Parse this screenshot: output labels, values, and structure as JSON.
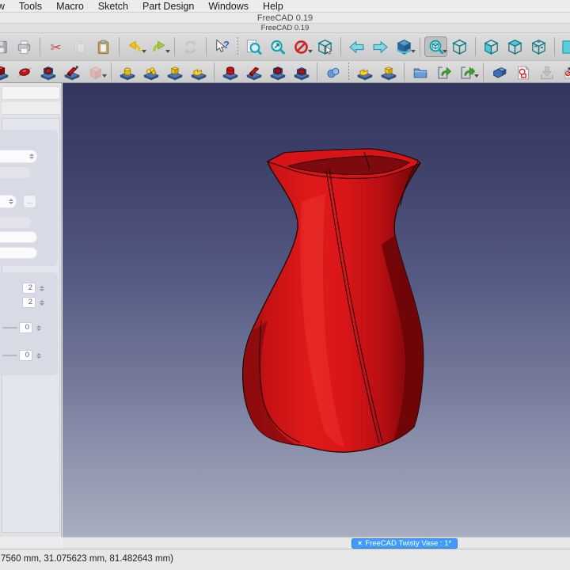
{
  "window": {
    "title": "FreeCAD 0.19",
    "inner_title": "FreeCAD 0.19"
  },
  "menu": {
    "items": [
      "View",
      "Tools",
      "Macro",
      "Sketch",
      "Part Design",
      "Windows",
      "Help"
    ]
  },
  "toolbar1": {
    "items": [
      {
        "name": "save-icon",
        "kind": "floppy",
        "partial": true
      },
      {
        "name": "print-icon",
        "kind": "printer"
      },
      {
        "sep": 1
      },
      {
        "name": "cut-icon",
        "kind": "scissors"
      },
      {
        "name": "copy-icon",
        "kind": "copy",
        "grayed": true
      },
      {
        "name": "paste-icon",
        "kind": "clipboard"
      },
      {
        "sep": 1
      },
      {
        "name": "undo-icon",
        "kind": "undo",
        "caret": true
      },
      {
        "name": "redo-icon",
        "kind": "redo",
        "caret": true
      },
      {
        "sep": 1
      },
      {
        "name": "refresh-icon",
        "kind": "refresh",
        "grayed": true
      },
      {
        "sep": 1
      },
      {
        "name": "whats-this-icon",
        "kind": "whatsthis"
      },
      {
        "sep": 2
      },
      {
        "name": "fit-all-icon",
        "kind": "magdoc"
      },
      {
        "name": "fit-selection-icon",
        "kind": "mag"
      },
      {
        "name": "draw-style-icon",
        "kind": "noentry",
        "caret": true
      },
      {
        "name": "box-selection-icon",
        "kind": "cubecursor"
      },
      {
        "sep": 1
      },
      {
        "name": "nav-back-icon",
        "kind": "arrowL"
      },
      {
        "name": "nav-forward-icon",
        "kind": "arrowR"
      },
      {
        "name": "fly-mode-icon",
        "kind": "flycube",
        "caret": true
      },
      {
        "sep": 1
      },
      {
        "name": "zoom-tools-icon",
        "kind": "magcube",
        "caret": true,
        "pressed": true
      },
      {
        "name": "axonometric-view-icon",
        "kind": "cubewire"
      },
      {
        "sep": 1
      },
      {
        "name": "front-view-icon",
        "kind": "cubefront"
      },
      {
        "name": "top-view-icon",
        "kind": "cubetop"
      },
      {
        "name": "right-view-icon",
        "kind": "cubex"
      },
      {
        "sep": 1
      },
      {
        "name": "rear-view-icon",
        "kind": "cyanpartial"
      }
    ]
  },
  "toolbar2": {
    "items": [
      {
        "name": "pad-icon",
        "kind": "rbox",
        "partial": true
      },
      {
        "name": "revolution-icon",
        "kind": "rdisc"
      },
      {
        "name": "additive-loft-icon",
        "kind": "rframe"
      },
      {
        "name": "additive-pipe-icon",
        "kind": "rpipe"
      },
      {
        "name": "additive-helix-icon",
        "kind": "ghost",
        "grayed": true,
        "caret": true
      },
      {
        "sep": 1
      },
      {
        "name": "additive-cylinder-icon",
        "kind": "ycyl"
      },
      {
        "name": "additive-sphere-icon",
        "kind": "yballs"
      },
      {
        "name": "additive-box-icon",
        "kind": "ybox"
      },
      {
        "name": "additive-primitives-icon",
        "kind": "ysteps"
      },
      {
        "sep": 1
      },
      {
        "name": "pocket-icon",
        "kind": "rround"
      },
      {
        "name": "subtractive-wedge-icon",
        "kind": "rwedge"
      },
      {
        "name": "groove-icon",
        "kind": "rframe2"
      },
      {
        "name": "subtractive-loft-icon",
        "kind": "rinner"
      },
      {
        "sep": 1
      },
      {
        "name": "boolean-icon",
        "kind": "spheres"
      },
      {
        "sep": 2
      },
      {
        "name": "shapebinder-icon",
        "kind": "ysteps"
      },
      {
        "name": "clone-icon",
        "kind": "ybox"
      },
      {
        "sep": 1
      },
      {
        "name": "group-icon",
        "kind": "folder"
      },
      {
        "name": "export-icon",
        "kind": "exporta"
      },
      {
        "name": "export-as-icon",
        "kind": "exportb",
        "caret": true
      },
      {
        "sep": 1
      },
      {
        "name": "part-icon",
        "kind": "partblue"
      },
      {
        "name": "sketch-icon",
        "kind": "sketchpage"
      },
      {
        "name": "import-icon",
        "kind": "importgray",
        "grayed": true
      },
      {
        "name": "std-part-icon",
        "kind": "stdcube"
      }
    ]
  },
  "sidebar": {
    "fields": {
      "dots_button": "…",
      "count1": "2",
      "count2": "2",
      "angle1": "0",
      "angle2": "0"
    }
  },
  "viewport": {
    "model_name": "red twisted vase",
    "gradient_top": "#33365e",
    "gradient_bottom": "#a8adc1",
    "vase_red": "#d61417"
  },
  "tabbar": {
    "close_glyph": "×",
    "active_label": "FreeCAD Twisty Vase : 1*",
    "accent": "#3f9bfc"
  },
  "statusbar": {
    "coordinates": "7560 mm, 31.075623 mm, 81.482643 mm)"
  }
}
